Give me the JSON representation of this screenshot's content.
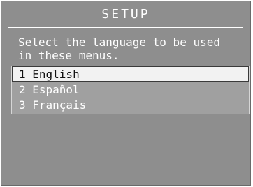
{
  "screen": {
    "title": "SETUP",
    "prompt_line1": "Select the language to be used",
    "prompt_line2": "in these menus."
  },
  "languages": {
    "selected_index": 0,
    "items": [
      {
        "label": "1 English"
      },
      {
        "label": "2 Español"
      },
      {
        "label": "3 Français"
      }
    ]
  },
  "colors": {
    "background": "#8e8e8e",
    "list_background": "#a0a0a0",
    "highlight": "#f2f2f2",
    "text": "#ffffff",
    "highlight_text": "#111111"
  }
}
